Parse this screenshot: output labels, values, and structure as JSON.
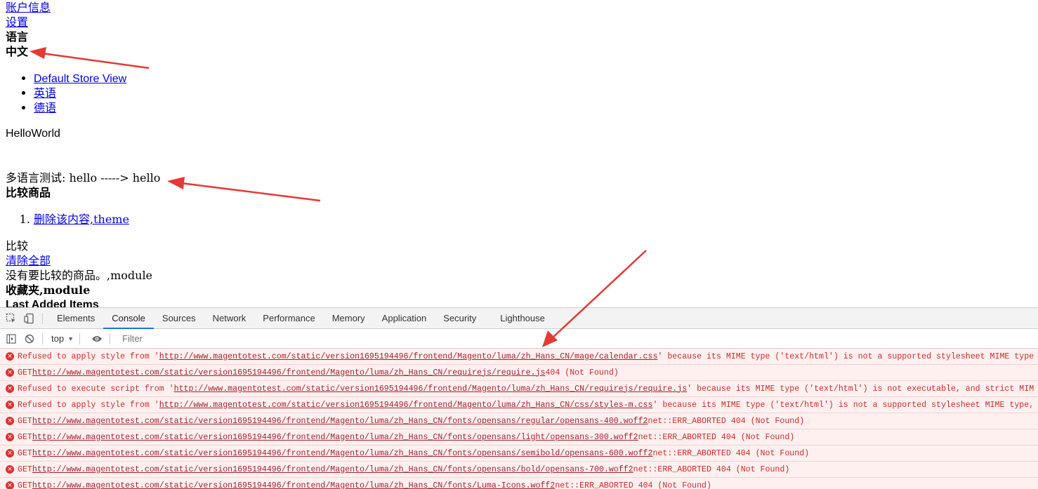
{
  "page": {
    "account_link": "账户信息",
    "settings_link": "设置",
    "language_heading": "语言",
    "current_language": "中文",
    "languages": [
      "Default Store View",
      "英语",
      "德语"
    ],
    "hello_text": "HelloWorld",
    "multi_lang_test": "多语言测试: hello -----> hello",
    "compare_heading": "比较商品",
    "compare_items": [
      "删除该内容,theme"
    ],
    "compare_label": "比较",
    "clear_all_link": "清除全部",
    "no_compare_text": "没有要比较的商品。,module",
    "wishlist_heading": "收藏夹,module",
    "last_added_heading": "Last Added Items"
  },
  "devtools": {
    "tabs": [
      "Elements",
      "Console",
      "Sources",
      "Network",
      "Performance",
      "Memory",
      "Application",
      "Security",
      "Lighthouse"
    ],
    "active_tab": "Console",
    "context": "top",
    "filter_placeholder": "Filter",
    "messages": [
      {
        "prefix": "Refused to apply style from '",
        "url": "http://www.magentotest.com/static/version1695194496/frontend/Magento/luma/zh_Hans_CN/mage/calendar.css",
        "suffix": "' because its MIME type ('text/html') is not a supported stylesheet MIME type"
      },
      {
        "prefix": "GET ",
        "url": "http://www.magentotest.com/static/version1695194496/frontend/Magento/luma/zh_Hans_CN/requirejs/require.js",
        "suffix": " 404 (Not Found)"
      },
      {
        "prefix": "Refused to execute script from '",
        "url": "http://www.magentotest.com/static/version1695194496/frontend/Magento/luma/zh_Hans_CN/requirejs/require.js",
        "suffix": "' because its MIME type ('text/html') is not executable, and strict MIM"
      },
      {
        "prefix": "Refused to apply style from '",
        "url": "http://www.magentotest.com/static/version1695194496/frontend/Magento/luma/zh_Hans_CN/css/styles-m.css",
        "suffix": "' because its MIME type ('text/html') is not a supported stylesheet MIME type,"
      },
      {
        "prefix": "GET ",
        "url": "http://www.magentotest.com/static/version1695194496/frontend/Magento/luma/zh_Hans_CN/fonts/opensans/regular/opensans-400.woff2",
        "suffix": " net::ERR_ABORTED 404 (Not Found)"
      },
      {
        "prefix": "GET ",
        "url": "http://www.magentotest.com/static/version1695194496/frontend/Magento/luma/zh_Hans_CN/fonts/opensans/light/opensans-300.woff2",
        "suffix": " net::ERR_ABORTED 404 (Not Found)"
      },
      {
        "prefix": "GET ",
        "url": "http://www.magentotest.com/static/version1695194496/frontend/Magento/luma/zh_Hans_CN/fonts/opensans/semibold/opensans-600.woff2",
        "suffix": " net::ERR_ABORTED 404 (Not Found)"
      },
      {
        "prefix": "GET ",
        "url": "http://www.magentotest.com/static/version1695194496/frontend/Magento/luma/zh_Hans_CN/fonts/opensans/bold/opensans-700.woff2",
        "suffix": " net::ERR_ABORTED 404 (Not Found)"
      },
      {
        "prefix": "GET ",
        "url": "http://www.magentotest.com/static/version1695194496/frontend/Magento/luma/zh_Hans_CN/fonts/Luma-Icons.woff2",
        "suffix": " net::ERR_ABORTED 404 (Not Found)"
      }
    ]
  },
  "colors": {
    "arrow": "#e53935",
    "error_text": "#d12a2a",
    "error_bg": "#fff0f0",
    "link": "#0000ee"
  }
}
